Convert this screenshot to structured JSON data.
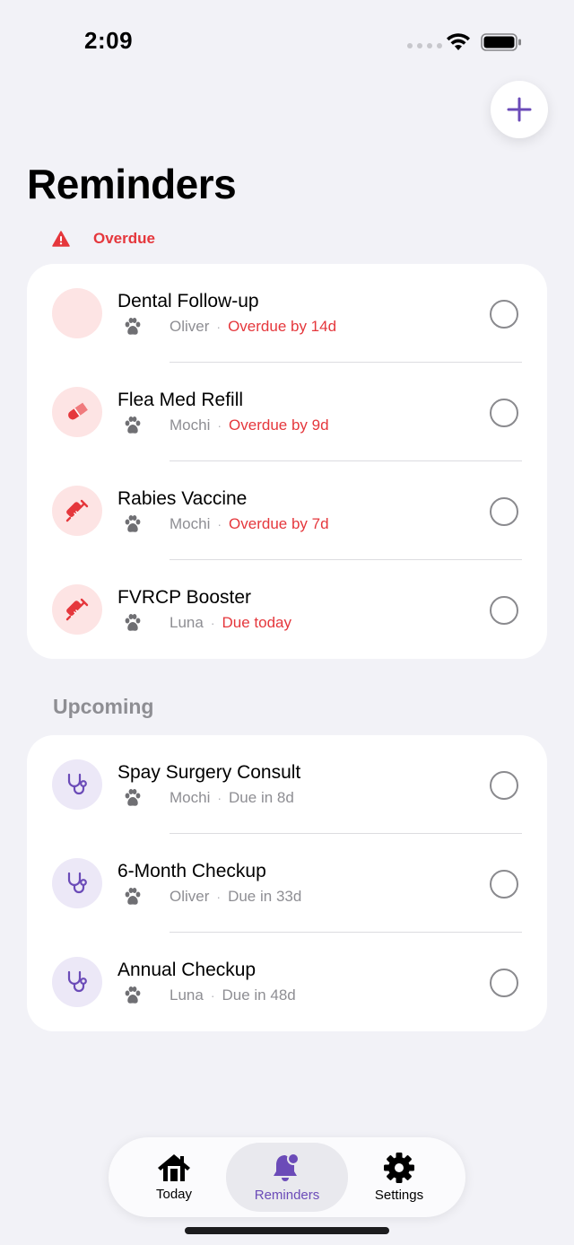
{
  "status_bar": {
    "time": "2:09"
  },
  "page": {
    "title": "Reminders"
  },
  "sections": {
    "overdue": {
      "label": "Overdue",
      "items": [
        {
          "title": "Dental Follow-up",
          "pet": "Oliver",
          "due": "Overdue by 14d",
          "icon": "none"
        },
        {
          "title": "Flea Med Refill",
          "pet": "Mochi",
          "due": "Overdue by 9d",
          "icon": "pill-icon"
        },
        {
          "title": "Rabies Vaccine",
          "pet": "Mochi",
          "due": "Overdue by 7d",
          "icon": "syringe-icon"
        },
        {
          "title": "FVRCP Booster",
          "pet": "Luna",
          "due": "Due today",
          "icon": "syringe-icon"
        }
      ]
    },
    "upcoming": {
      "label": "Upcoming",
      "items": [
        {
          "title": "Spay Surgery Consult",
          "pet": "Mochi",
          "due": "Due in 8d",
          "icon": "stethoscope-icon"
        },
        {
          "title": "6-Month Checkup",
          "pet": "Oliver",
          "due": "Due in 33d",
          "icon": "stethoscope-icon"
        },
        {
          "title": "Annual Checkup",
          "pet": "Luna",
          "due": "Due in 48d",
          "icon": "stethoscope-icon"
        }
      ]
    }
  },
  "tab_bar": {
    "today": "Today",
    "reminders": "Reminders",
    "settings": "Settings",
    "selected": "reminders"
  },
  "colors": {
    "accent": "#6b4bb8",
    "danger": "#e5373c",
    "background": "#f2f2f7"
  }
}
